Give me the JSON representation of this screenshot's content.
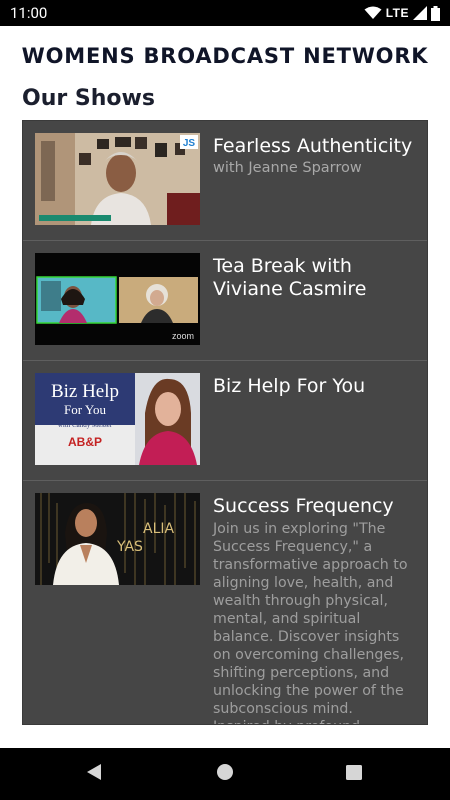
{
  "status_bar": {
    "time": "11:00",
    "network": "LTE"
  },
  "header": {
    "title": "WOMENS BROADCAST NETWORK"
  },
  "section": {
    "title": "Our Shows"
  },
  "shows": [
    {
      "title": "Fearless Authenticity",
      "subtitle": "with Jeanne Sparrow",
      "thumb_badge": "JS"
    },
    {
      "title": "Tea Break with Viviane Casmire",
      "thumb_badge": "zoom"
    },
    {
      "title": "Biz Help For You",
      "thumb_line1": "Biz Help",
      "thumb_line2": "For You",
      "thumb_line3": "with Candy Messer",
      "thumb_logo": "AB&P"
    },
    {
      "title": "Success Frequency",
      "description": "Join us in exploring \"The Success Frequency,\" a transformative approach to aligning love, health, and wealth through physical, mental, and spiritual balance. Discover insights on overcoming challenges, shifting perceptions, and unlocking the power of the subconscious mind. Inspired by profound",
      "thumb_text1": "ALIA",
      "thumb_text2": "YAS"
    }
  ],
  "colors": {
    "list_bg": "#464646",
    "title_text": "#ffffff",
    "secondary_text": "#a8a8a8",
    "header_text": "#101528"
  },
  "icons": [
    "wifi-icon",
    "signal-icon",
    "battery-icon",
    "back-icon",
    "home-icon",
    "recents-icon"
  ]
}
